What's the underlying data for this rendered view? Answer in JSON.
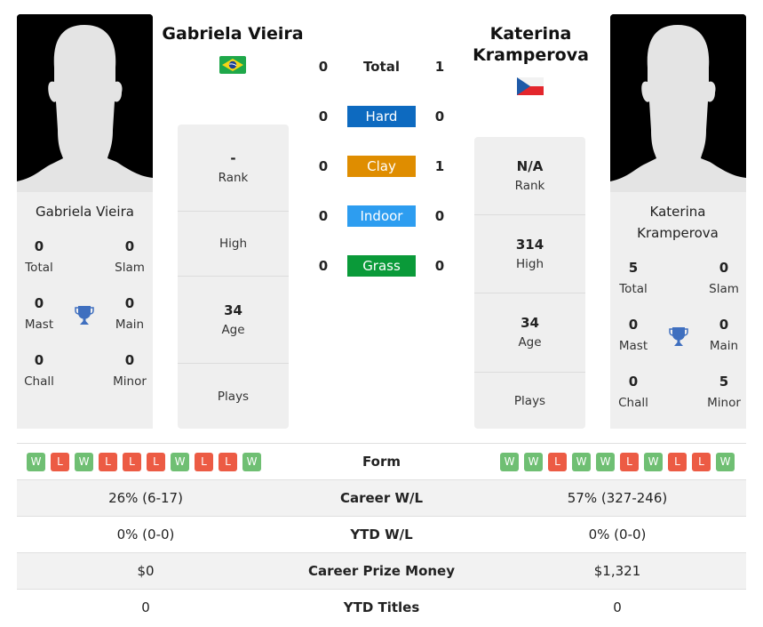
{
  "colors": {
    "hard": "#0d6ac0",
    "clay": "#df8d00",
    "indoor": "#2d9df0",
    "grass": "#0a9a39",
    "win": "#6fbf73",
    "loss": "#ec5b44",
    "trophy": "#3f6fbf"
  },
  "players": {
    "left": {
      "name": "Gabriela Vieira",
      "flag": "brazil-flag",
      "titles": {
        "total": {
          "value": "0",
          "label": "Total"
        },
        "slam": {
          "value": "0",
          "label": "Slam"
        },
        "mast": {
          "value": "0",
          "label": "Mast"
        },
        "main": {
          "value": "0",
          "label": "Main"
        },
        "chall": {
          "value": "0",
          "label": "Chall"
        },
        "minor": {
          "value": "0",
          "label": "Minor"
        }
      },
      "info": {
        "rank": {
          "value": "-",
          "label": "Rank"
        },
        "high": {
          "value": "",
          "label": "High"
        },
        "age": {
          "value": "34",
          "label": "Age"
        },
        "plays": {
          "value": "",
          "label": "Plays"
        }
      }
    },
    "right": {
      "name": "Katerina Kramperova",
      "flag": "czech-flag",
      "titles": {
        "total": {
          "value": "5",
          "label": "Total"
        },
        "slam": {
          "value": "0",
          "label": "Slam"
        },
        "mast": {
          "value": "0",
          "label": "Mast"
        },
        "main": {
          "value": "0",
          "label": "Main"
        },
        "chall": {
          "value": "0",
          "label": "Chall"
        },
        "minor": {
          "value": "5",
          "label": "Minor"
        }
      },
      "info": {
        "rank": {
          "value": "N/A",
          "label": "Rank"
        },
        "high": {
          "value": "314",
          "label": "High"
        },
        "age": {
          "value": "34",
          "label": "Age"
        },
        "plays": {
          "value": "",
          "label": "Plays"
        }
      }
    }
  },
  "h2h": [
    {
      "label": "Total",
      "left": "0",
      "right": "1",
      "surface": "total"
    },
    {
      "label": "Hard",
      "left": "0",
      "right": "0",
      "surface": "hard"
    },
    {
      "label": "Clay",
      "left": "0",
      "right": "1",
      "surface": "clay"
    },
    {
      "label": "Indoor",
      "left": "0",
      "right": "0",
      "surface": "indoor"
    },
    {
      "label": "Grass",
      "left": "0",
      "right": "0",
      "surface": "grass"
    }
  ],
  "comparison": {
    "form": {
      "label": "Form",
      "left": [
        "W",
        "L",
        "W",
        "L",
        "L",
        "L",
        "W",
        "L",
        "L",
        "W"
      ],
      "right": [
        "W",
        "W",
        "L",
        "W",
        "W",
        "L",
        "W",
        "L",
        "L",
        "W"
      ]
    },
    "rows": [
      {
        "label": "Career W/L",
        "left": "26% (6-17)",
        "right": "57% (327-246)"
      },
      {
        "label": "YTD W/L",
        "left": "0% (0-0)",
        "right": "0% (0-0)"
      },
      {
        "label": "Career Prize Money",
        "left": "$0",
        "right": "$1,321"
      },
      {
        "label": "YTD Titles",
        "left": "0",
        "right": "0"
      }
    ]
  }
}
